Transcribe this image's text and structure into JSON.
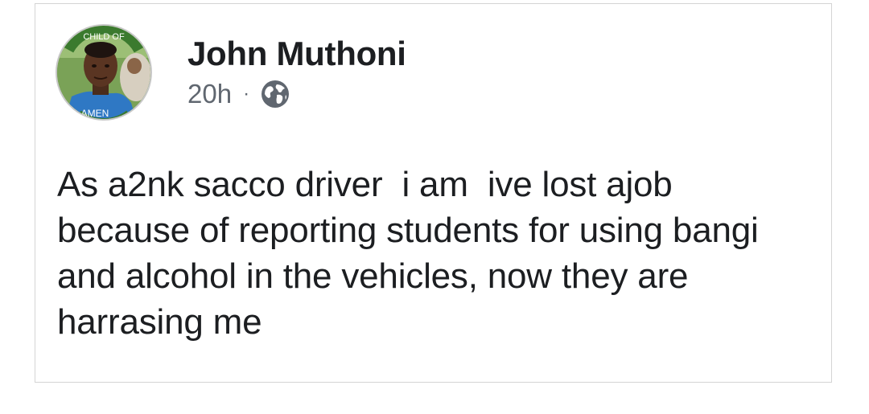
{
  "post": {
    "author": "John Muthoni",
    "timestamp": "20h",
    "separator": "·",
    "audience_icon": "globe-icon",
    "avatar_text_top": "CHILD OF",
    "avatar_text_bottom": "AMEN",
    "body": "As a2nk sacco driver  i am  ive lost ajob because of reporting students for using bangi and alcohol in the vehicles, now they are harrasing me"
  }
}
